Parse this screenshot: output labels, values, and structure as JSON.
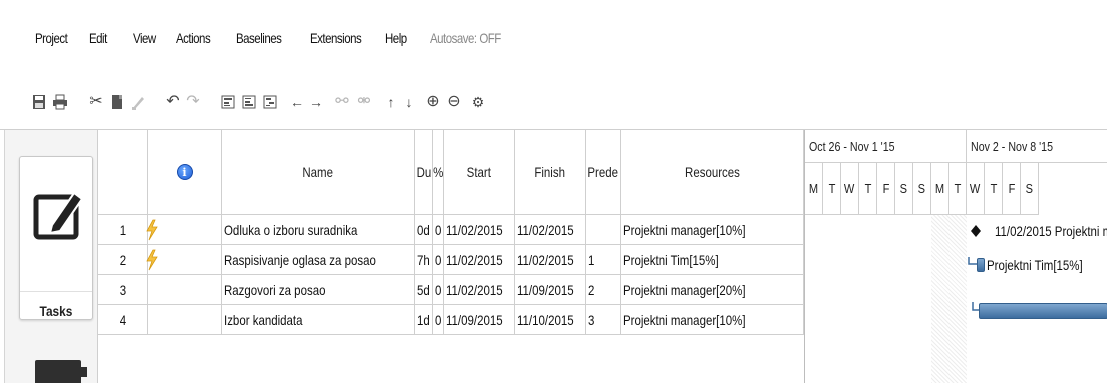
{
  "menu": {
    "items": [
      "Project",
      "Edit",
      "View",
      "Actions",
      "Baselines",
      "Extensions",
      "Help"
    ],
    "autosave": "Autosave: OFF"
  },
  "toolbar": {
    "icons": [
      "save-icon",
      "print-icon",
      "cut-icon",
      "copy-icon",
      "paste-icon",
      "undo-icon",
      "redo-icon",
      "insert-above-icon",
      "insert-below-icon",
      "insert-child-icon",
      "outdent-icon",
      "indent-icon",
      "link-icon",
      "unlink-icon",
      "move-up-icon",
      "move-down-icon",
      "zoom-in-icon",
      "zoom-out-icon",
      "settings-icon"
    ],
    "glyphs": {
      "cut": "✂",
      "undo": "↶",
      "redo": "↷",
      "left": "←",
      "right": "→",
      "link": "⚯",
      "unlink": "⚮",
      "up": "↑",
      "down": "↓",
      "zoom_in": "⊕",
      "zoom_out": "⊖",
      "gear": "⚙"
    }
  },
  "sidebar": {
    "tasks_label": "Tasks"
  },
  "grid": {
    "columns": {
      "index": "",
      "info": "i",
      "name": "Name",
      "duration": "Du",
      "percent": "%",
      "start": "Start",
      "finish": "Finish",
      "predecessors": "Prede",
      "resources": "Resources"
    },
    "rows": [
      {
        "index": "1",
        "warning": true,
        "name": "Odluka o izboru suradnika",
        "duration": "0d",
        "percent": "0",
        "start": "11/02/2015",
        "finish": "11/02/2015",
        "predecessors": "",
        "resources": "Projektni manager[10%]"
      },
      {
        "index": "2",
        "warning": true,
        "name": "Raspisivanje oglasa za posao",
        "duration": "7h",
        "percent": "0",
        "start": "11/02/2015",
        "finish": "11/02/2015",
        "predecessors": "1",
        "resources": "Projektni Tim[15%]"
      },
      {
        "index": "3",
        "warning": false,
        "name": "Razgovori za posao",
        "duration": "5d",
        "percent": "0",
        "start": "11/02/2015",
        "finish": "11/09/2015",
        "predecessors": "2",
        "resources": "Projektni manager[20%]"
      },
      {
        "index": "4",
        "warning": false,
        "name": "Izbor kandidata",
        "duration": "1d",
        "percent": "0",
        "start": "11/09/2015",
        "finish": "11/10/2015",
        "predecessors": "3",
        "resources": "Projektni manager[10%]"
      }
    ]
  },
  "gantt": {
    "weeks": [
      {
        "label": "Oct 26 - Nov 1 '15",
        "days": [
          "M",
          "T",
          "W",
          "T",
          "F",
          "S",
          "S"
        ]
      },
      {
        "label": "Nov 2 - Nov 8 '15",
        "days": [
          "M",
          "T",
          "W",
          "T",
          "F",
          "S"
        ]
      }
    ],
    "milestone_label": "11/02/2015 Projektni m",
    "task2_label": "Projektni Tim[15%]",
    "colors": {
      "bar": "#4f7fb0",
      "milestone": "#111111"
    }
  }
}
